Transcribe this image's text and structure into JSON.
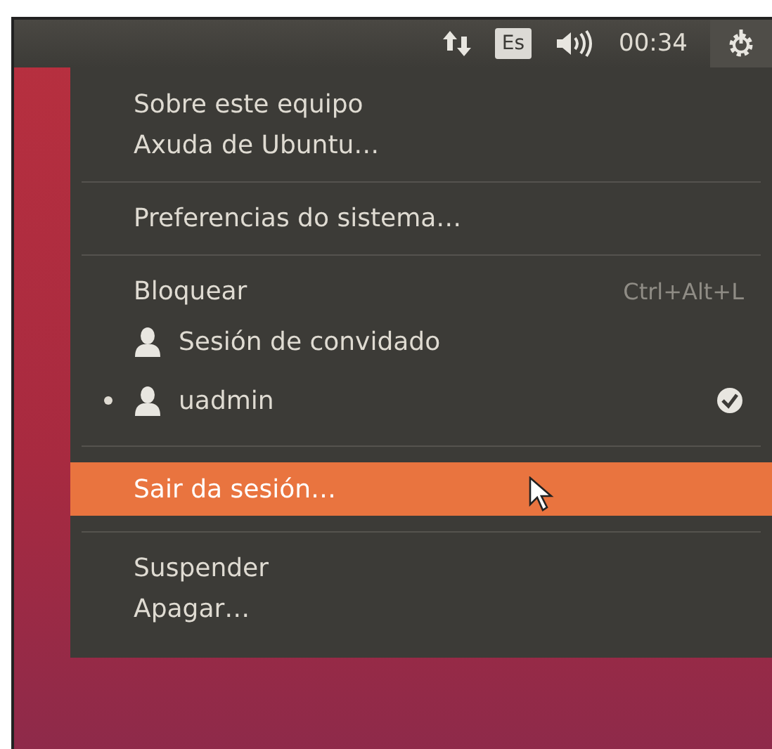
{
  "panel": {
    "keyboard_layout": "Es",
    "clock": "00:34"
  },
  "menu": {
    "sections": [
      [
        {
          "label": "Sobre este equipo",
          "kind": "plain",
          "selected": false
        },
        {
          "label": "Axuda de Ubuntu…",
          "kind": "plain",
          "selected": false
        }
      ],
      [
        {
          "label": "Preferencias do sistema…",
          "kind": "plain",
          "selected": false
        }
      ],
      [
        {
          "label": "Bloquear",
          "kind": "plain",
          "shortcut": "Ctrl+Alt+L",
          "selected": false
        },
        {
          "label": "Sesión de convidado",
          "kind": "user",
          "current": false,
          "checked": false,
          "selected": false
        },
        {
          "label": "uadmin",
          "kind": "user",
          "current": true,
          "checked": true,
          "selected": false
        }
      ],
      [
        {
          "label": "Sair da sesión…",
          "kind": "plain",
          "selected": true
        }
      ],
      [
        {
          "label": "Suspender",
          "kind": "plain",
          "selected": false
        },
        {
          "label": "Apagar…",
          "kind": "plain",
          "selected": false
        }
      ]
    ]
  }
}
